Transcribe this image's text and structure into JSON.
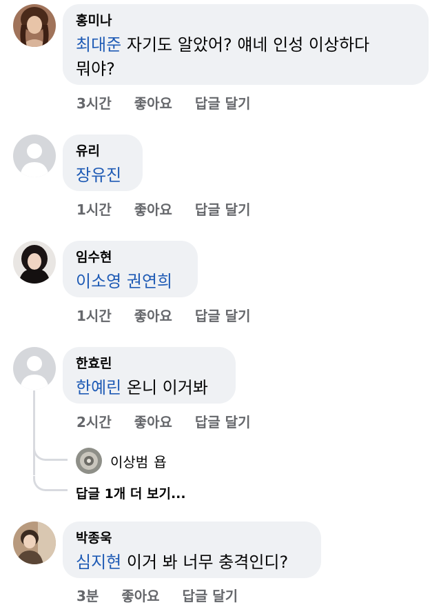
{
  "comments": [
    {
      "name": "홍미나",
      "mention": "최대준",
      "text": " 자기도 알았어? 얘네 인성 이상하다",
      "text_line2": "뭐야?",
      "time": "3시간",
      "like": "좋아요",
      "reply": "답글 달기"
    },
    {
      "name": "유리",
      "mention": "장유진",
      "text": "",
      "time": "1시간",
      "like": "좋아요",
      "reply": "답글 달기"
    },
    {
      "name": "임수현",
      "mention": "이소영 권연희",
      "text": "",
      "time": "1시간",
      "like": "좋아요",
      "reply": "답글 달기"
    },
    {
      "name": "한효린",
      "mention": "한예린",
      "text": " 온니 이거봐",
      "time": "2시간",
      "like": "좋아요",
      "reply": "답글 달기",
      "replies": [
        {
          "name": "이상범",
          "text": "욥"
        }
      ],
      "more_replies": "답글 1개 더 보기..."
    },
    {
      "name": "박종욱",
      "mention": "심지현",
      "text": " 이거 봐 너무 충격인디?",
      "time": "3분",
      "like": "좋아요",
      "reply": "답글 달기"
    }
  ],
  "colors": {
    "bubble": "#eff1f4",
    "mention": "#1f5bb5",
    "meta": "#65676b",
    "thread": "#d8dadf"
  }
}
